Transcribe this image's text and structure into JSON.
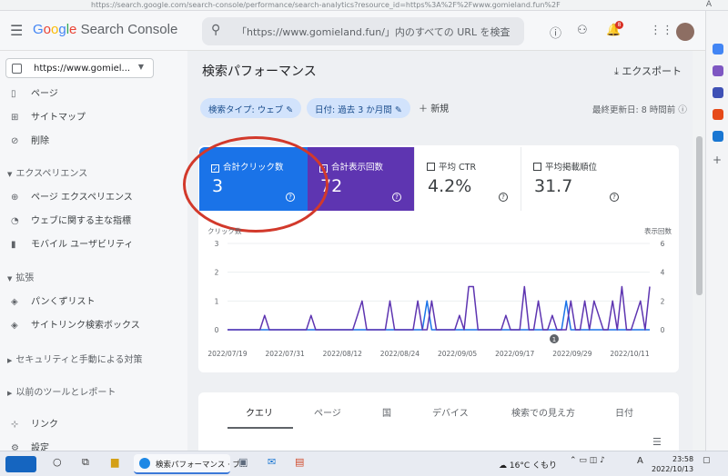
{
  "browser": {
    "url": "https://search.google.com/search-console/performance/search-analytics?resource_id=https%3A%2F%2Fwww.gomieland.fun%2F",
    "right_text": "A"
  },
  "header": {
    "logo_google": "Google",
    "logo_product": "Search Console",
    "search_placeholder": "「https://www.gomieland.fun/」内のすべての URL を検査",
    "notification_count": "8"
  },
  "sidebar": {
    "property": "https://www.gomiel...",
    "items_top": [
      {
        "label": "ページ",
        "icon": "page-icon"
      },
      {
        "label": "サイトマップ",
        "icon": "sitemap-icon"
      },
      {
        "label": "削除",
        "icon": "removals-icon"
      }
    ],
    "sections": [
      {
        "title": "エクスペリエンス",
        "items": [
          {
            "label": "ページ エクスペリエンス",
            "icon": "plus-circle-icon"
          },
          {
            "label": "ウェブに関する主な指標",
            "icon": "gauge-icon"
          },
          {
            "label": "モバイル ユーザビリティ",
            "icon": "phone-icon"
          }
        ]
      },
      {
        "title": "拡張",
        "items": [
          {
            "label": "パンくずリスト",
            "icon": "layers-icon"
          },
          {
            "label": "サイトリンク検索ボックス",
            "icon": "layers-icon"
          }
        ]
      }
    ],
    "collapsed": [
      "セキュリティと手動による対策",
      "以前のツールとレポート"
    ],
    "bottom": [
      {
        "label": "リンク",
        "icon": "links-icon"
      },
      {
        "label": "設定",
        "icon": "gear-icon"
      }
    ]
  },
  "page": {
    "title": "検索パフォーマンス",
    "export": "エクスポート",
    "filters": [
      "検索タイプ: ウェブ",
      "日付: 過去 3 か月間"
    ],
    "new": "新規",
    "updated": "最終更新日: 8 時間前"
  },
  "metrics": [
    {
      "label": "合計クリック数",
      "value": "3",
      "checked": true,
      "color": "#1a73e8"
    },
    {
      "label": "合計表示回数",
      "value": "72",
      "checked": true,
      "color": "#5e35b1"
    },
    {
      "label": "平均 CTR",
      "value": "4.2%",
      "checked": false
    },
    {
      "label": "平均掲載順位",
      "value": "31.7",
      "checked": false
    }
  ],
  "chart_data": {
    "type": "line",
    "left_axis_label": "クリック数",
    "right_axis_label": "表示回数",
    "left_ticks": [
      "3",
      "2",
      "1",
      "0"
    ],
    "right_ticks": [
      "6",
      "4",
      "2",
      "0"
    ],
    "ylim_left": [
      0,
      3
    ],
    "ylim_right": [
      0,
      6
    ],
    "x_labels": [
      "2022/07/19",
      "2022/07/31",
      "2022/08/12",
      "2022/08/24",
      "2022/09/05",
      "2022/09/17",
      "2022/09/29",
      "2022/10/11"
    ],
    "annotation": "1",
    "series": [
      {
        "name": "合計クリック数",
        "axis": "left",
        "color": "#1a73e8",
        "values": [
          0,
          0,
          0,
          0,
          0,
          0,
          0,
          0,
          0,
          0,
          0,
          0,
          0,
          0,
          0,
          0,
          0,
          0,
          0,
          0,
          0,
          0,
          0,
          0,
          0,
          0,
          0,
          0,
          0,
          0,
          0,
          0,
          0,
          0,
          0,
          0,
          0,
          0,
          0,
          0,
          0,
          0,
          0,
          1,
          0,
          0,
          0,
          0,
          0,
          0,
          0,
          0,
          0,
          0,
          0,
          0,
          0,
          0,
          0,
          0,
          0,
          0,
          0,
          0,
          0,
          0,
          0,
          0,
          0,
          0,
          0,
          0,
          0,
          1,
          0,
          0,
          0,
          0,
          0,
          0,
          0,
          0,
          0,
          0,
          0,
          0,
          0,
          0,
          0,
          0,
          0,
          0
        ]
      },
      {
        "name": "合計表示回数",
        "axis": "right",
        "color": "#5e35b1",
        "values": [
          0,
          0,
          0,
          0,
          0,
          0,
          0,
          0,
          1,
          0,
          0,
          0,
          0,
          0,
          0,
          0,
          0,
          0,
          1,
          0,
          0,
          0,
          0,
          0,
          0,
          0,
          0,
          0,
          1,
          2,
          0,
          0,
          0,
          0,
          0,
          2,
          0,
          0,
          0,
          0,
          0,
          2,
          0,
          0,
          2,
          0,
          0,
          0,
          0,
          0,
          1,
          0,
          3,
          3,
          0,
          0,
          0,
          0,
          0,
          0,
          1,
          0,
          0,
          0,
          3,
          0,
          0,
          2,
          0,
          0,
          1,
          0,
          0,
          0,
          2,
          0,
          0,
          2,
          0,
          2,
          1,
          0,
          0,
          2,
          0,
          3,
          0,
          0,
          1,
          2,
          0,
          3
        ]
      }
    ]
  },
  "tabs": [
    "クエリ",
    "ページ",
    "国",
    "デバイス",
    "検索での見え方",
    "日付"
  ],
  "taskbar": {
    "app_title": "検索パフォーマンス · ブ...",
    "weather": "16°C くもり",
    "time": "23:58",
    "date": "2022/10/13",
    "ime": "A"
  }
}
